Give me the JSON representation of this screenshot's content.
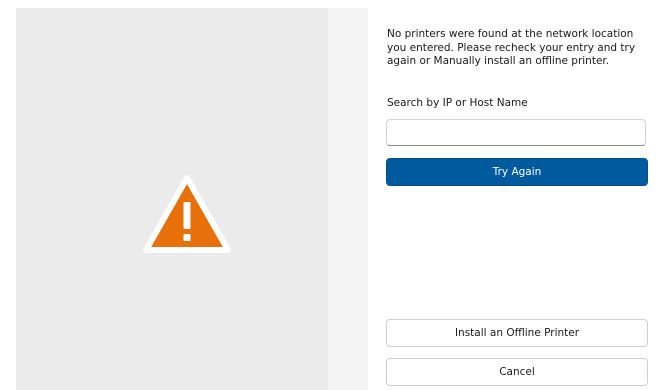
{
  "dialog": {
    "icon": "warning-icon",
    "message": "No printers were found at the network location you entered. Please recheck your entry and try again or Manually install an offline printer.",
    "search_label": "Search by IP or Host Name",
    "search_value": "",
    "try_again_label": "Try Again",
    "install_offline_label": "Install an Offline Printer",
    "cancel_label": "Cancel"
  },
  "colors": {
    "accent": "#005a9e",
    "warning": "#e8700a",
    "left_pane": "#ebebeb"
  }
}
